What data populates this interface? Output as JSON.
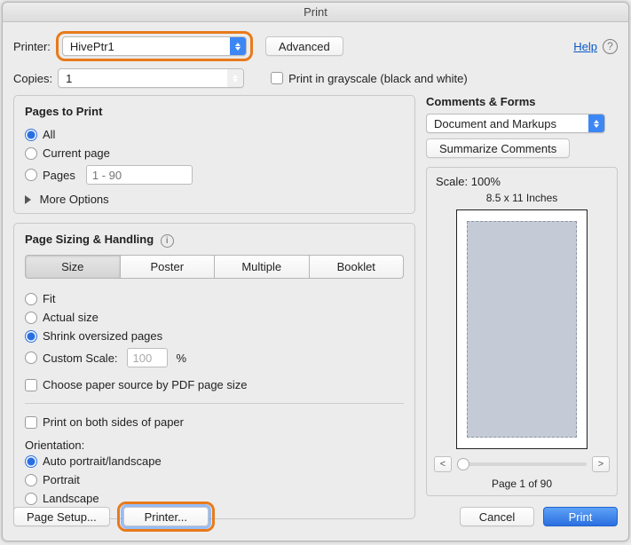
{
  "window": {
    "title": "Print"
  },
  "toolbar": {
    "printer_label": "Printer:",
    "printer_value": "HivePtr1",
    "advanced_label": "Advanced",
    "copies_label": "Copies:",
    "copies_value": "1",
    "grayscale_label": "Print in grayscale (black and white)",
    "help_label": "Help"
  },
  "pages_to_print": {
    "title": "Pages to Print",
    "all": "All",
    "current": "Current page",
    "pages": "Pages",
    "pages_placeholder": "1 - 90",
    "more_options": "More Options"
  },
  "sizing": {
    "title": "Page Sizing & Handling",
    "segments": {
      "size": "Size",
      "poster": "Poster",
      "multiple": "Multiple",
      "booklet": "Booklet"
    },
    "fit": "Fit",
    "actual": "Actual size",
    "shrink": "Shrink oversized pages",
    "custom_scale_label": "Custom Scale:",
    "custom_scale_value": "100",
    "percent": "%",
    "choose_paper": "Choose paper source by PDF page size",
    "duplex": "Print on both sides of paper",
    "orientation_label": "Orientation:",
    "auto": "Auto portrait/landscape",
    "portrait": "Portrait",
    "landscape": "Landscape"
  },
  "comments": {
    "title": "Comments & Forms",
    "select_value": "Document and Markups",
    "summarize": "Summarize Comments"
  },
  "preview": {
    "scale": "Scale: 100%",
    "paper": "8.5 x 11 Inches",
    "page_of": "Page 1 of 90",
    "prev": "<",
    "next": ">"
  },
  "buttons": {
    "page_setup": "Page Setup...",
    "printer": "Printer...",
    "cancel": "Cancel",
    "print": "Print"
  }
}
